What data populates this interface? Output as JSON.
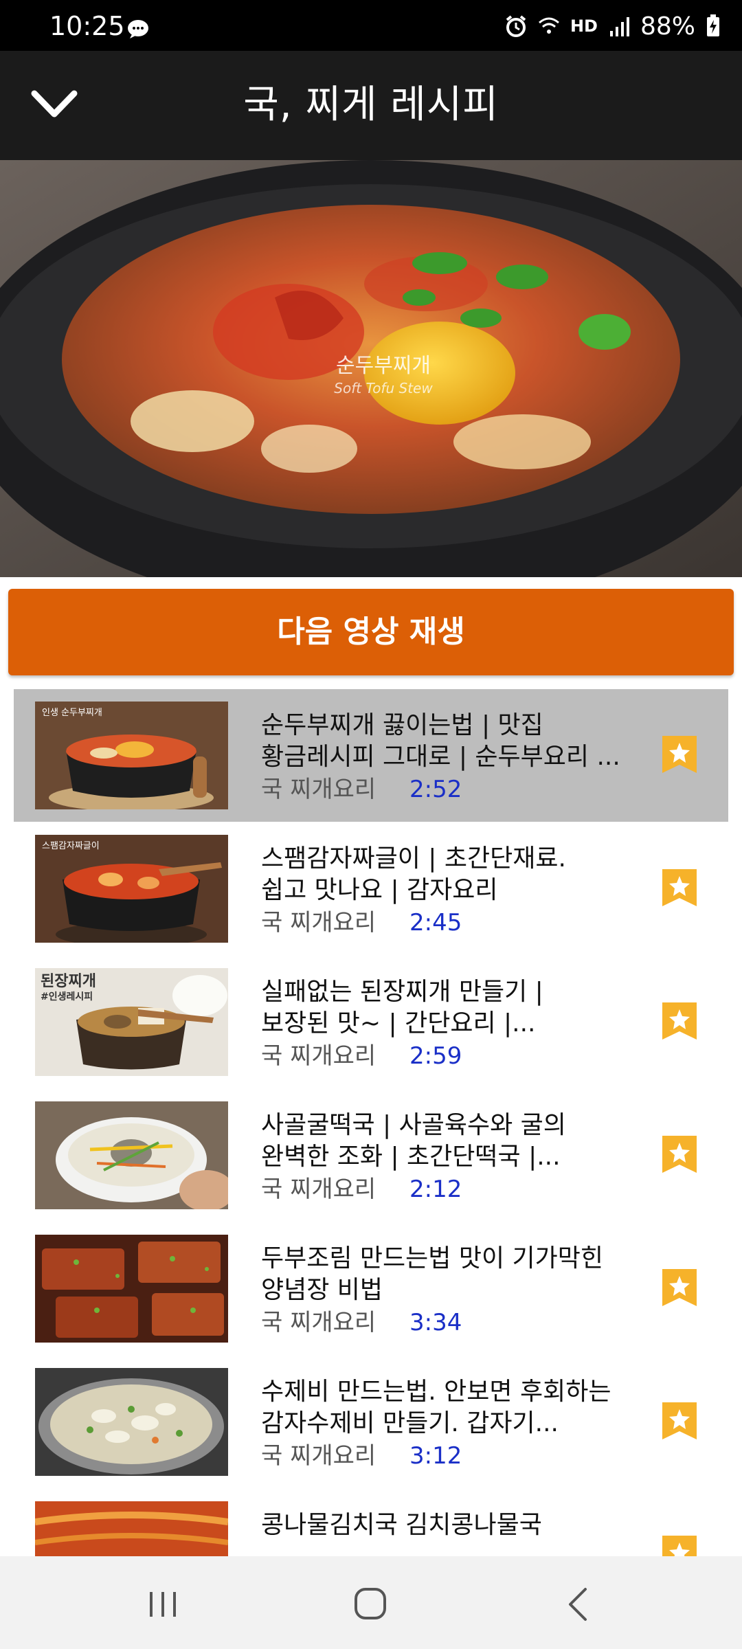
{
  "status_bar": {
    "time": "10:25",
    "network_label": "HD",
    "battery": "88%"
  },
  "header": {
    "title": "국, 찌게 레시피"
  },
  "hero": {
    "caption_ko": "순두부찌개",
    "caption_en": "Soft Tofu Stew"
  },
  "next_button": {
    "label": "다음 영상 재생"
  },
  "videos": [
    {
      "title": "순두부찌개 끓이는법 | 맛집\n황금레시피 그대로 | 순두부요리 ...",
      "category": "국 찌개요리",
      "duration": "2:52",
      "thumb_label": "인생 순두부찌개",
      "selected": true
    },
    {
      "title": "스팸감자짜글이 | 초간단재료.\n쉽고 맛나요 | 감자요리",
      "category": "국 찌개요리",
      "duration": "2:45",
      "thumb_label": "스팸감자짜글이",
      "selected": false
    },
    {
      "title": "실패없는 된장찌개 만들기 |\n보장된 맛~ | 간단요리 |...",
      "category": "국 찌개요리",
      "duration": "2:59",
      "thumb_label": "된장찌개",
      "thumb_sublabel": "#인생레시피",
      "selected": false
    },
    {
      "title": "사골굴떡국 | 사골육수와 굴의\n완벽한 조화  | 초간단떡국 |...",
      "category": "국 찌개요리",
      "duration": "2:12",
      "selected": false
    },
    {
      "title": "두부조림 만드는법 맛이 기가막힌\n양념장 비법",
      "category": "국 찌개요리",
      "duration": "3:34",
      "selected": false
    },
    {
      "title": "수제비 만드는법. 안보면 후회하는\n감자수제비 만들기. 갑자기...",
      "category": "국 찌개요리",
      "duration": "3:12",
      "selected": false
    },
    {
      "title": "콩나물김치국 김치콩나물국",
      "category": "",
      "duration": "",
      "selected": false
    }
  ],
  "colors": {
    "accent_orange": "#dc5f06",
    "bookmark_yellow": "#f6b22a",
    "duration_blue": "#1a2fc7",
    "selected_row": "#bdbdbd"
  },
  "icons": {
    "back": "chevron-down-icon",
    "bookmark": "bookmark-star-icon"
  }
}
